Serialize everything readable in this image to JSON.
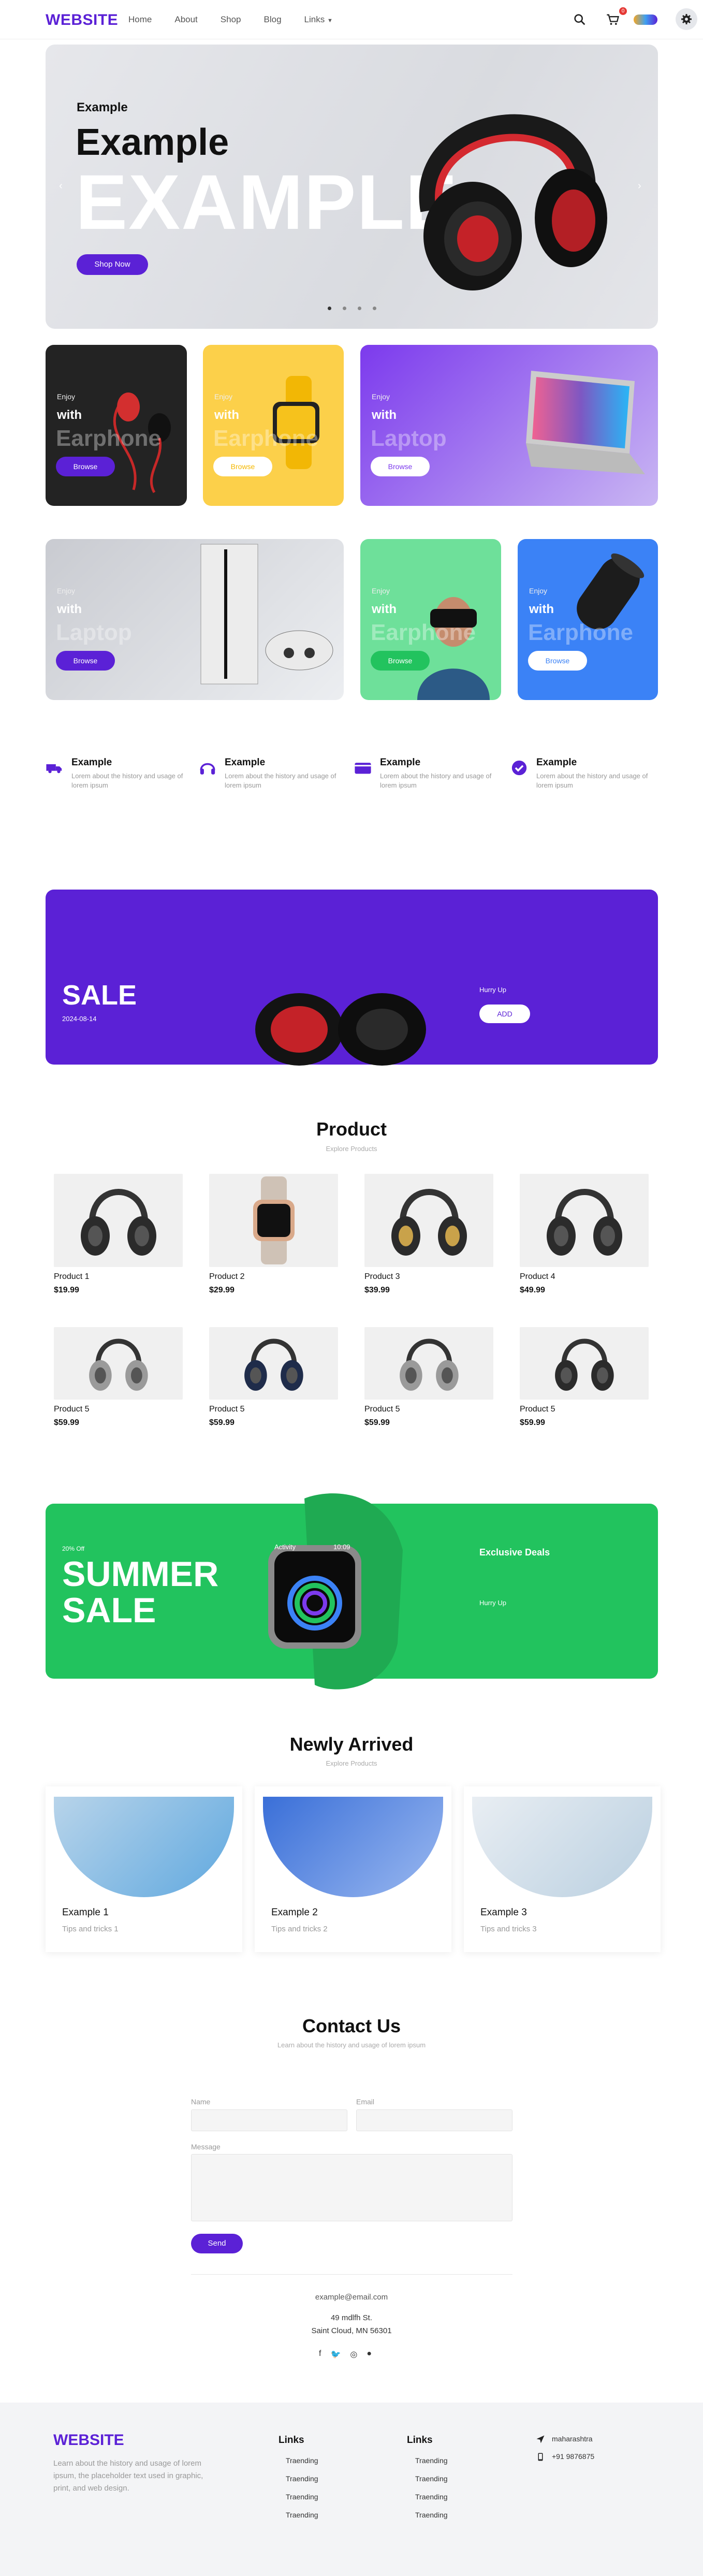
{
  "header": {
    "logo": "WEBSITE",
    "nav": [
      "Home",
      "About",
      "Shop",
      "Blog",
      "Links"
    ],
    "cart_count": "0"
  },
  "hero": {
    "subtitle": "Example",
    "title": "Example",
    "big_text": "EXAMPLE",
    "button": "Shop Now",
    "slides": 4,
    "active_slide": 1
  },
  "categories": [
    {
      "enjoy": "Enjoy",
      "with": "with",
      "ghost": "Earphone",
      "button": "Browse",
      "bg": "#222222"
    },
    {
      "enjoy": "Enjoy",
      "with": "with",
      "ghost": "Earphone",
      "button": "Browse",
      "bg": "#fcd04a"
    },
    {
      "enjoy": "Enjoy",
      "with": "with",
      "ghost": "Laptop",
      "button": "Browse",
      "bg": "#7c3aed"
    },
    {
      "enjoy": "Enjoy",
      "with": "with",
      "ghost": "Laptop",
      "button": "Browse",
      "bg": "#d4d6dc"
    },
    {
      "enjoy": "Enjoy",
      "with": "with",
      "ghost": "Earphone",
      "button": "Browse",
      "bg": "#6ee09a"
    },
    {
      "enjoy": "Enjoy",
      "with": "with",
      "ghost": "Earphone",
      "button": "Browse",
      "bg": "#3b82f6"
    }
  ],
  "features": [
    {
      "title": "Example",
      "desc": "Lorem about the history and usage of lorem ipsum",
      "icon": "truck-icon"
    },
    {
      "title": "Example",
      "desc": "Lorem about the history and usage of lorem ipsum",
      "icon": "headphones-icon"
    },
    {
      "title": "Example",
      "desc": "Lorem about the history and usage of lorem ipsum",
      "icon": "wallet-icon"
    },
    {
      "title": "Example",
      "desc": "Lorem about the history and usage of lorem ipsum",
      "icon": "check-badge-icon"
    }
  ],
  "sale_banner": {
    "sale": "SALE",
    "date": "2024-08-14",
    "hurry": "Hurry Up",
    "button": "ADD"
  },
  "products": {
    "title": "Product",
    "subtitle": "Explore Products",
    "items": [
      {
        "name": "Product 1",
        "price": "$19.99"
      },
      {
        "name": "Product 2",
        "price": "$29.99"
      },
      {
        "name": "Product 3",
        "price": "$39.99"
      },
      {
        "name": "Product 4",
        "price": "$49.99"
      },
      {
        "name": "Product 5",
        "price": "$59.99"
      },
      {
        "name": "Product 5",
        "price": "$59.99"
      },
      {
        "name": "Product 5",
        "price": "$59.99"
      },
      {
        "name": "Product 5",
        "price": "$59.99"
      }
    ]
  },
  "summer": {
    "off": "20% Off",
    "line1": "SUMMER",
    "line2": "SALE",
    "deals": "Exclusive Deals",
    "hurry": "Hurry Up",
    "watch_activity": "Activity",
    "watch_time": "10:09"
  },
  "newly": {
    "title": "Newly Arrived",
    "subtitle": "Explore Products",
    "items": [
      {
        "title": "Example 1",
        "desc": "Tips and tricks 1"
      },
      {
        "title": "Example 2",
        "desc": "Tips and tricks 2"
      },
      {
        "title": "Example 3",
        "desc": "Tips and tricks 3"
      }
    ]
  },
  "contact": {
    "title": "Contact Us",
    "subtitle": "Learn about the history and usage of lorem ipsum",
    "name_label": "Name",
    "email_label": "Email",
    "message_label": "Message",
    "send": "Send",
    "email": "example@email.com",
    "address1": "49 mdlfh St.",
    "address2": "Saint Cloud, MN 56301"
  },
  "footer": {
    "logo": "WEBSITE",
    "desc": "Learn about the history and usage of lorem ipsum, the placeholder text used in graphic, print, and web design.",
    "col1_title": "Links",
    "col1_links": [
      "Traending",
      "Traending",
      "Traending",
      "Traending"
    ],
    "col2_title": "Links",
    "col2_links": [
      "Traending",
      "Traending",
      "Traending",
      "Traending"
    ],
    "location": "maharashtra",
    "phone": "+91 9876875"
  }
}
